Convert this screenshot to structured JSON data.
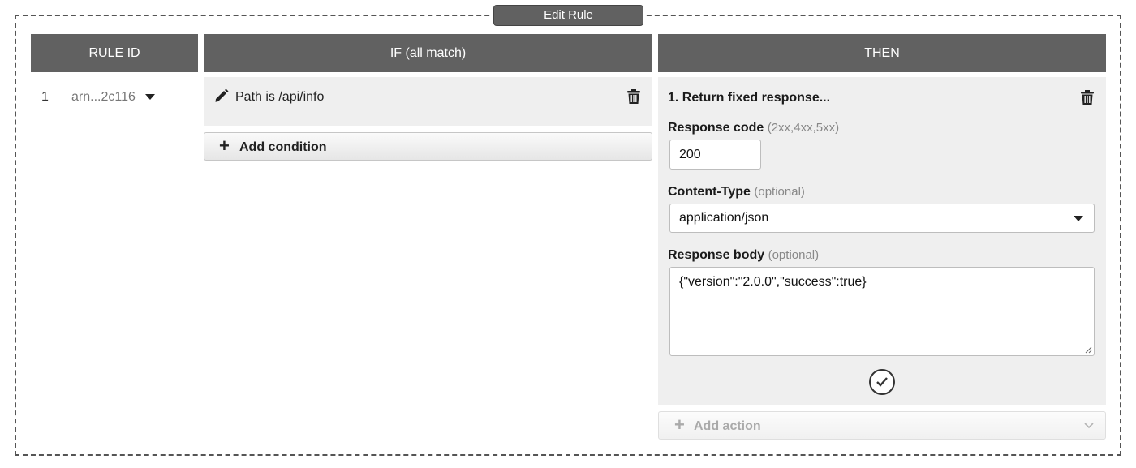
{
  "header": {
    "edit_rule_label": "Edit Rule"
  },
  "columns": {
    "rule_id": "RULE ID",
    "if": "IF (all match)",
    "then": "THEN"
  },
  "rule": {
    "number": "1",
    "arn": "arn...2c116"
  },
  "condition": {
    "text": "Path is /api/info",
    "add_condition_label": "Add condition"
  },
  "action": {
    "title": "1. Return fixed response...",
    "response_code_label": "Response code",
    "response_code_hint": "(2xx,4xx,5xx)",
    "response_code_value": "200",
    "content_type_label": "Content-Type",
    "content_type_hint": "(optional)",
    "content_type_value": "application/json",
    "response_body_label": "Response body",
    "response_body_hint": "(optional)",
    "response_body_value": "{\"version\":\"2.0.0\",\"success\":true}",
    "add_action_label": "Add action"
  },
  "icons": [
    "pencil-icon",
    "trash-icon",
    "plus-icon",
    "chevron-down-icon",
    "caret-down-icon",
    "checkmark-icon",
    "resize-handle-icon"
  ]
}
